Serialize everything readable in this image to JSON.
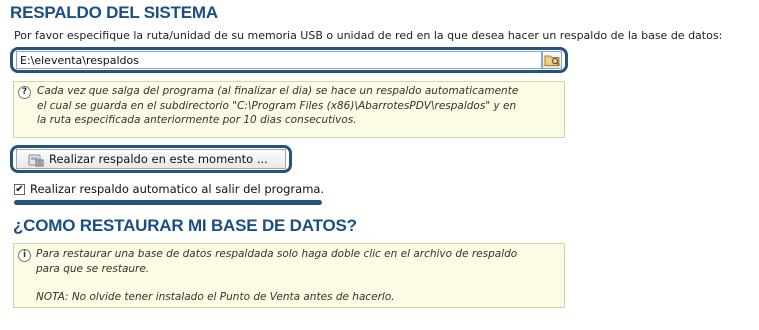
{
  "backup": {
    "title": "RESPALDO DEL SISTEMA",
    "description": "Por favor especifique la ruta/unidad de su memoria USB o unidad de red en la que desea hacer un respaldo de la base de datos:",
    "path_value": "E:\\eleventa\\respaldos",
    "info_lines": [
      "Cada vez que salga del programa (al finalizar el dia) se hace un respaldo automaticamente",
      "el cual se guarda en el subdirectorio \"C:\\Program Files (x86)\\AbarrotesPDV\\respaldos\" y en",
      "la ruta especificada anteriormente por 10 dias consecutivos."
    ],
    "backup_now_label": "Realizar respaldo en este momento ...",
    "auto_backup_label": "Realizar respaldo automatico al salir del programa.",
    "auto_backup_checked": true
  },
  "restore": {
    "title": "¿COMO RESTAURAR MI BASE DE DATOS?",
    "info_lines": [
      "Para restaurar una base de datos respaldada solo haga doble clic en el archivo de respaldo",
      "para que se restaure."
    ],
    "note": "NOTA: No olvide tener instalado el Punto de Venta antes de hacerlo."
  },
  "icons": {
    "browse": "folder-icon",
    "info": "question-icon",
    "backup_button": "database-save-icon"
  },
  "colors": {
    "heading": "#1a4f86",
    "highlight": "#24537f",
    "info_background": "#fcfbe3"
  }
}
